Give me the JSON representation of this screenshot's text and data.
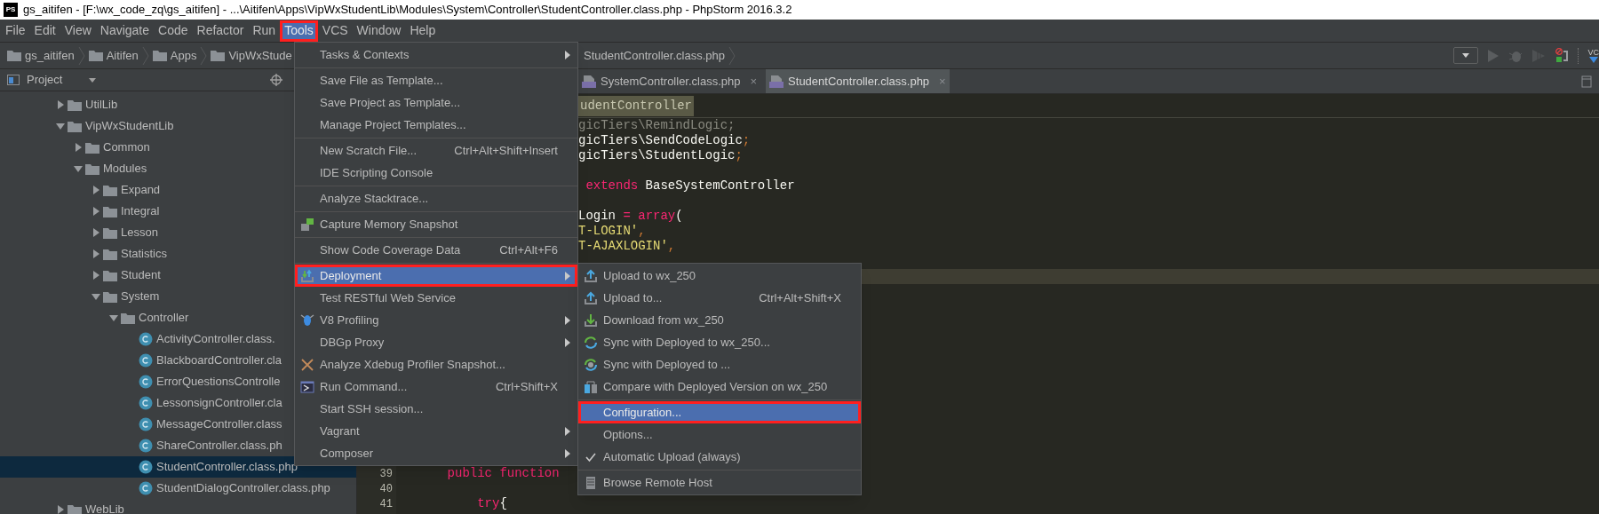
{
  "title_bar": {
    "logo_text": "PS",
    "title": "gs_aitifen - [F:\\wx_code_zq\\gs_aitifen] - ...\\Aitifen\\Apps\\VipWxStudentLib\\Modules\\System\\Controller\\StudentController.class.php - PhpStorm 2016.3.2"
  },
  "menu_bar": [
    {
      "label": "File",
      "selected": false
    },
    {
      "label": "Edit",
      "selected": false
    },
    {
      "label": "View",
      "selected": false
    },
    {
      "label": "Navigate",
      "selected": false
    },
    {
      "label": "Code",
      "selected": false
    },
    {
      "label": "Refactor",
      "selected": false
    },
    {
      "label": "Run",
      "selected": false
    },
    {
      "label": "Tools",
      "selected": true
    },
    {
      "label": "VCS",
      "selected": false
    },
    {
      "label": "Window",
      "selected": false
    },
    {
      "label": "Help",
      "selected": false
    }
  ],
  "navigation_bar": {
    "crumbs": [
      {
        "label": "gs_aitifen",
        "kind": "folder"
      },
      {
        "label": "Aitifen",
        "kind": "folder"
      },
      {
        "label": "Apps",
        "kind": "folder"
      },
      {
        "label": "VipWxStude",
        "kind": "folder"
      },
      {
        "label": "StudentController.class.php",
        "kind": "file"
      }
    ],
    "vcs_icon_text": "VC"
  },
  "project_panel": {
    "title": "Project",
    "tree": [
      {
        "label": "UtilLib",
        "kind": "folder",
        "expanded": false,
        "selected": false
      },
      {
        "label": "VipWxStudentLib",
        "kind": "folder",
        "expanded": true,
        "selected": false,
        "children": [
          {
            "label": "Common",
            "kind": "folder",
            "expanded": false,
            "selected": false
          },
          {
            "label": "Modules",
            "kind": "folder",
            "expanded": true,
            "selected": false,
            "children": [
              {
                "label": "Expand",
                "kind": "folder",
                "expanded": false,
                "selected": false
              },
              {
                "label": "Integral",
                "kind": "folder",
                "expanded": false,
                "selected": false
              },
              {
                "label": "Lesson",
                "kind": "folder",
                "expanded": false,
                "selected": false
              },
              {
                "label": "Statistics",
                "kind": "folder",
                "expanded": false,
                "selected": false
              },
              {
                "label": "Student",
                "kind": "folder",
                "expanded": false,
                "selected": false
              },
              {
                "label": "System",
                "kind": "folder",
                "expanded": true,
                "selected": false,
                "children": [
                  {
                    "label": "Controller",
                    "kind": "folder",
                    "expanded": true,
                    "selected": false,
                    "children": [
                      {
                        "label": "ActivityController.class.",
                        "kind": "class",
                        "selected": false
                      },
                      {
                        "label": "BlackboardController.cla",
                        "kind": "class",
                        "selected": false
                      },
                      {
                        "label": "ErrorQuestionsControlle",
                        "kind": "class",
                        "selected": false
                      },
                      {
                        "label": "LessonsignController.cla",
                        "kind": "class",
                        "selected": false
                      },
                      {
                        "label": "MessageController.class",
                        "kind": "class",
                        "selected": false
                      },
                      {
                        "label": "ShareController.class.ph",
                        "kind": "class",
                        "selected": false
                      },
                      {
                        "label": "StudentController.class.php",
                        "kind": "class",
                        "selected": true
                      },
                      {
                        "label": "StudentDialogController.class.php",
                        "kind": "class",
                        "selected": false
                      }
                    ]
                  }
                ]
              }
            ]
          }
        ]
      },
      {
        "label": "WebLib",
        "kind": "folder",
        "expanded": false,
        "selected": false
      }
    ]
  },
  "editor": {
    "tabs": [
      {
        "label": "SystemController.class.php",
        "close": "×",
        "selected": false
      },
      {
        "label": "StudentController.class.php",
        "close": "×",
        "selected": true
      }
    ],
    "class_crumb": "udentController",
    "lines_top": [
      {
        "kind": "fragment",
        "current": false,
        "tokens": [
          {
            "text": "gicTiers\\RemindLogic;",
            "kind": "unused"
          }
        ]
      },
      {
        "kind": "fragment",
        "current": false,
        "tokens": [
          {
            "text": "gicTiers\\SendCodeLogic",
            "kind": "plain"
          },
          {
            "text": ";",
            "kind": "punct"
          }
        ]
      },
      {
        "kind": "fragment",
        "current": false,
        "tokens": [
          {
            "text": "gicTiers\\StudentLogic",
            "kind": "plain"
          },
          {
            "text": ";",
            "kind": "punct"
          }
        ]
      },
      {
        "kind": "code",
        "current": false
      },
      {
        "kind": "fragment",
        "current": false,
        "tokens": [
          {
            "text": " extends",
            "kind": "keyword"
          },
          {
            "text": " BaseSystemController",
            "kind": "plain"
          }
        ]
      },
      {
        "kind": "code",
        "current": false
      },
      {
        "kind": "fragment",
        "current": false,
        "tokens": [
          {
            "text": "Login ",
            "kind": "plain"
          },
          {
            "text": "= array",
            "kind": "keyword"
          },
          {
            "text": "(",
            "kind": "plain"
          }
        ]
      },
      {
        "kind": "fragment",
        "current": false,
        "tokens": [
          {
            "text": "T-LOGIN'",
            "kind": "string"
          },
          {
            "text": ",",
            "kind": "punct"
          }
        ]
      },
      {
        "kind": "fragment",
        "current": false,
        "tokens": [
          {
            "text": "T-AJAXLOGIN'",
            "kind": "string"
          },
          {
            "text": ",",
            "kind": "punct"
          }
        ]
      },
      {
        "kind": "code",
        "current": false
      },
      {
        "kind": "code",
        "current": true
      }
    ],
    "lines_bottom": [
      {
        "kind": "code",
        "number": "39",
        "current": false,
        "tokens": [
          {
            "text": "    public function",
            "kind": "keyword"
          }
        ]
      },
      {
        "kind": "code",
        "number": "40",
        "current": false
      },
      {
        "kind": "code",
        "number": "41",
        "current": false,
        "tokens": [
          {
            "text": "        try",
            "kind": "keyword"
          },
          {
            "text": "{",
            "kind": "plain"
          }
        ]
      }
    ]
  },
  "tools_menu": [
    {
      "kind": "item",
      "label": "Tasks & Contexts",
      "has_submenu": true,
      "selected": false
    },
    {
      "kind": "separator"
    },
    {
      "kind": "item",
      "label": "Save File as Template...",
      "has_submenu": false,
      "selected": false
    },
    {
      "kind": "item",
      "label": "Save Project as Template...",
      "has_submenu": false,
      "selected": false
    },
    {
      "kind": "item",
      "label": "Manage Project Templates...",
      "has_submenu": false,
      "selected": false
    },
    {
      "kind": "separator"
    },
    {
      "kind": "item",
      "label": "New Scratch File...",
      "shortcut": "Ctrl+Alt+Shift+Insert",
      "has_submenu": false,
      "selected": false
    },
    {
      "kind": "item",
      "label": "IDE Scripting Console",
      "has_submenu": false,
      "selected": false
    },
    {
      "kind": "separator"
    },
    {
      "kind": "item",
      "label": "Analyze Stacktrace...",
      "has_submenu": false,
      "selected": false
    },
    {
      "kind": "separator"
    },
    {
      "kind": "item",
      "label": "Capture Memory Snapshot",
      "has_submenu": false,
      "selected": false
    },
    {
      "kind": "separator"
    },
    {
      "kind": "item",
      "label": "Show Code Coverage Data",
      "shortcut": "Ctrl+Alt+F6",
      "has_submenu": false,
      "selected": false
    },
    {
      "kind": "separator"
    },
    {
      "kind": "item",
      "label": "Deployment",
      "has_submenu": true,
      "selected": true
    },
    {
      "kind": "item",
      "label": "Test RESTful Web Service",
      "has_submenu": false,
      "selected": false
    },
    {
      "kind": "item",
      "label": "V8 Profiling",
      "has_submenu": true,
      "selected": false
    },
    {
      "kind": "item",
      "label": "DBGp Proxy",
      "has_submenu": true,
      "selected": false
    },
    {
      "kind": "item",
      "label": "Analyze Xdebug Profiler Snapshot...",
      "has_submenu": false,
      "selected": false
    },
    {
      "kind": "item",
      "label": "Run Command...",
      "shortcut": "Ctrl+Shift+X",
      "has_submenu": false,
      "selected": false
    },
    {
      "kind": "item",
      "label": "Start SSH session...",
      "has_submenu": false,
      "selected": false
    },
    {
      "kind": "item",
      "label": "Vagrant",
      "has_submenu": true,
      "selected": false
    },
    {
      "kind": "item",
      "label": "Composer",
      "has_submenu": true,
      "selected": false
    }
  ],
  "deployment_submenu": [
    {
      "kind": "item",
      "label": "Upload to wx_250",
      "checked": false,
      "selected": false
    },
    {
      "kind": "item",
      "label": "Upload to...",
      "shortcut": "Ctrl+Alt+Shift+X",
      "checked": false,
      "selected": false
    },
    {
      "kind": "item",
      "label": "Download from wx_250",
      "checked": false,
      "selected": false
    },
    {
      "kind": "item",
      "label": "Sync with Deployed to wx_250...",
      "checked": false,
      "selected": false
    },
    {
      "kind": "item",
      "label": "Sync with Deployed to ...",
      "checked": false,
      "selected": false
    },
    {
      "kind": "item",
      "label": "Compare with Deployed Version on wx_250",
      "checked": false,
      "selected": false
    },
    {
      "kind": "separator"
    },
    {
      "kind": "item",
      "label": "Configuration...",
      "checked": false,
      "selected": true
    },
    {
      "kind": "item",
      "label": "Options...",
      "checked": false,
      "selected": false
    },
    {
      "kind": "item",
      "label": "Automatic Upload (always)",
      "checked": true,
      "selected": false
    },
    {
      "kind": "separator"
    },
    {
      "kind": "item",
      "label": "Browse Remote Host",
      "checked": false,
      "selected": false
    }
  ]
}
